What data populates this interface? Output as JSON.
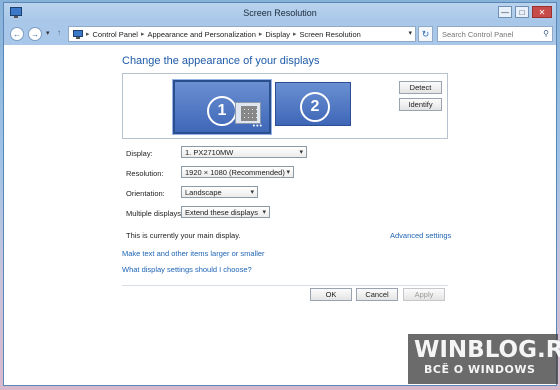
{
  "window": {
    "title": "Screen Resolution",
    "controls": {
      "minimize": "—",
      "maximize": "□",
      "close": "✕"
    }
  },
  "address": {
    "back_icon": "←",
    "forward_icon": "→",
    "dropdown_icon": "▾",
    "up_icon": "↑",
    "breadcrumb": [
      "Control Panel",
      "Appearance and Personalization",
      "Display",
      "Screen Resolution"
    ],
    "separator": "▸",
    "refresh_icon": "↻",
    "search_placeholder": "Search Control Panel",
    "search_icon": "⚲"
  },
  "main": {
    "heading": "Change the appearance of your displays",
    "monitors": [
      {
        "number": "1",
        "selected": true
      },
      {
        "number": "2",
        "selected": false
      }
    ],
    "monitor_dots": "•••",
    "detect_label": "Detect",
    "identify_label": "Identify",
    "fields": {
      "display": {
        "label": "Display:",
        "value": "1. PX2710MW"
      },
      "resolution": {
        "label": "Resolution:",
        "value": "1920 × 1080 (Recommended)"
      },
      "orientation": {
        "label": "Orientation:",
        "value": "Landscape"
      },
      "multiple": {
        "label": "Multiple displays:",
        "value": "Extend these displays"
      }
    },
    "chevron": "▾",
    "main_display_text": "This is currently your main display.",
    "advanced_link": "Advanced settings",
    "link_text_size": "Make text and other items larger or smaller",
    "link_which_settings": "What display settings should I choose?",
    "ok_label": "OK",
    "cancel_label": "Cancel",
    "apply_label": "Apply"
  },
  "watermark": {
    "title": "WINBLOG.RU",
    "subtitle": "ВСЁ О WINDOWS"
  },
  "colors": {
    "accent_blue": "#1e5aa8",
    "link_blue": "#1e64b4",
    "monitor_blue": "#4a70bd",
    "titlebar": "#b0cdeb"
  }
}
